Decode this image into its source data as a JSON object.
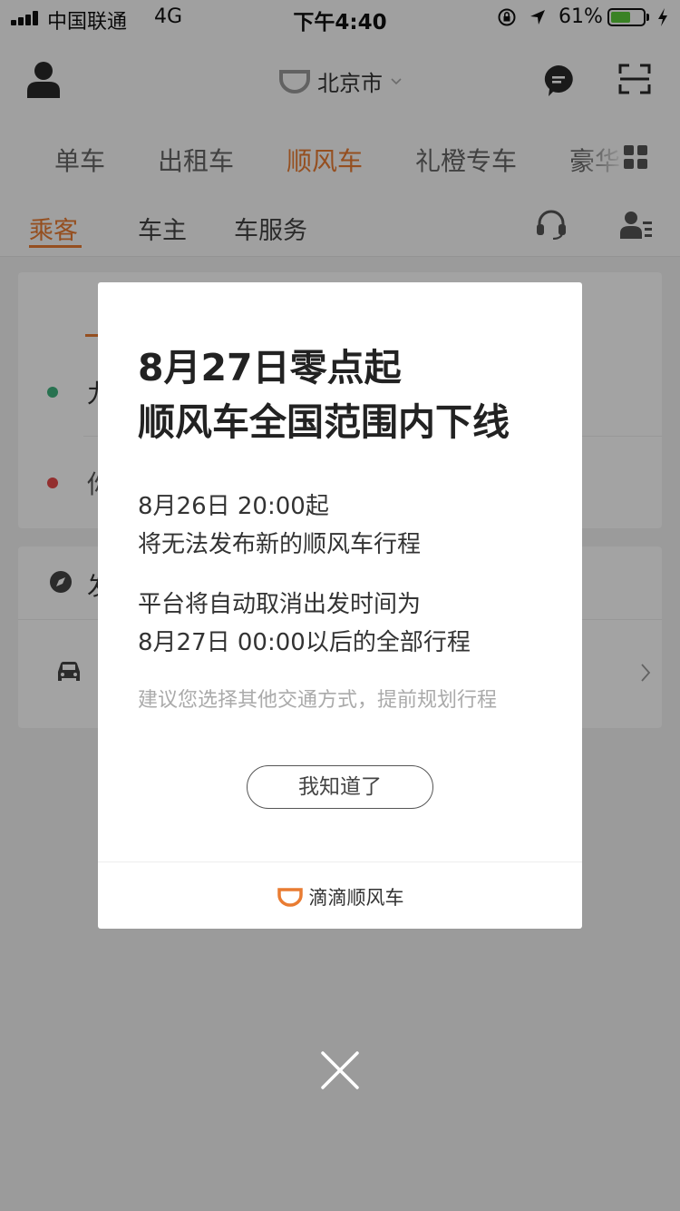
{
  "status_bar": {
    "carrier": "中国联通",
    "network": "4G",
    "time": "下午4:40",
    "battery_text": "61%",
    "battery_level": 0.61,
    "battery_color": "#5ccc3a"
  },
  "header": {
    "city": "北京市",
    "icons": {
      "profile": "user-profile-icon",
      "logo": "didi-logo-icon",
      "messages": "message-bubble-icon",
      "scan": "scan-icon"
    }
  },
  "service_tabs": [
    "单车",
    "出租车",
    "顺风车",
    "礼橙专车",
    "豪华"
  ],
  "service_tab_active": "顺风车",
  "role_tabs": [
    "乘客",
    "车主",
    "车服务"
  ],
  "role_tab_active": "乘客",
  "background": {
    "card1": {
      "peek_line1": "九",
      "peek_line2": "你"
    },
    "card2": {
      "peek_line1": "发"
    }
  },
  "dialog": {
    "title_line1": "8月27日零点起",
    "title_line2": "顺风车全国范围内下线",
    "p1_line1": "8月26日 20:00起",
    "p1_line2": "将无法发布新的顺风车行程",
    "p2_line1": "平台将自动取消出发时间为",
    "p2_line2": "8月27日 00:00以后的全部行程",
    "hint": "建议您选择其他交通方式，提前规划行程",
    "button": "我知道了",
    "footer_brand": "滴滴顺风车"
  },
  "colors": {
    "accent": "#e97c32",
    "dot_start": "#3fb37e",
    "dot_end": "#e64a4a"
  }
}
